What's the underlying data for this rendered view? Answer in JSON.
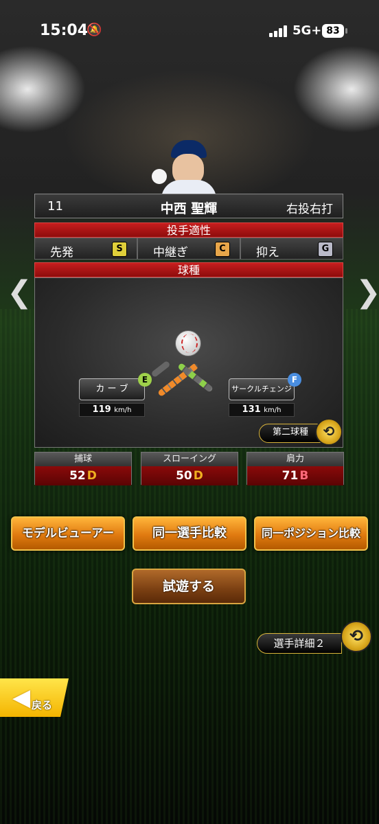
{
  "status": {
    "time": "15:04",
    "network": "5G+",
    "battery": "83"
  },
  "player": {
    "number": "11",
    "name": "中西 聖輝",
    "throw_bat": "右投右打"
  },
  "aptitude": {
    "title": "投手適性",
    "roles": [
      {
        "label": "先発",
        "grade": "S",
        "color": "#e0cf3a"
      },
      {
        "label": "中継ぎ",
        "grade": "C",
        "color": "#e8a64a"
      },
      {
        "label": "抑え",
        "grade": "G",
        "color": "#b9b9c8"
      }
    ]
  },
  "pitches": {
    "title": "球種",
    "items": [
      {
        "name": "カ ー ブ",
        "grade": "E",
        "grade_color": "#9ed04a",
        "speed": "119",
        "unit": "km/h"
      },
      {
        "name": "サークルチェンジ",
        "grade": "F",
        "grade_color": "#4a8ee0",
        "speed": "131",
        "unit": "km/h"
      }
    ],
    "second_pitch_label": "第二球種"
  },
  "stats": [
    {
      "label": "捕球",
      "value": "52",
      "grade": "D",
      "grade_color": "#f0b020"
    },
    {
      "label": "スローイング",
      "value": "50",
      "grade": "D",
      "grade_color": "#f0b020"
    },
    {
      "label": "肩力",
      "value": "71",
      "grade": "B",
      "grade_color": "#ff6a7a"
    }
  ],
  "buttons": {
    "model_viewer": "モデルビューアー",
    "same_player_compare": "同一選手比較",
    "same_position_compare": "同一ポジション比較",
    "trial": "試遊する",
    "detail2": "選手詳細２",
    "back": "戻る"
  },
  "icons": {
    "nav_left": "chevron-left-icon",
    "nav_right": "chevron-right-icon",
    "swap": "swap-icon"
  }
}
